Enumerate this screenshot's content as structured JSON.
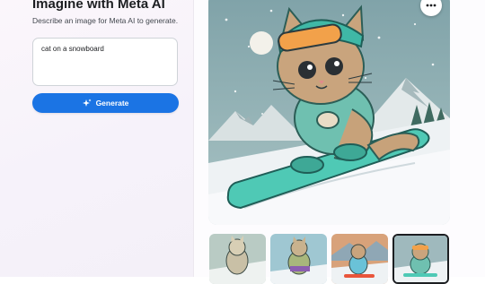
{
  "app": {
    "title": "Imagine with Meta AI",
    "subtitle": "Describe an image for Meta AI to generate."
  },
  "prompt": {
    "value": "cat on a snowboard"
  },
  "generate_button": {
    "label": "Generate",
    "icon": "sparkle-icon"
  },
  "image_options": {
    "icon": "more-options-icon"
  },
  "thumbnails": [
    {
      "name": "variation-1",
      "selected": false
    },
    {
      "name": "variation-2",
      "selected": false
    },
    {
      "name": "variation-3",
      "selected": false
    },
    {
      "name": "variation-4",
      "selected": true
    }
  ],
  "colors": {
    "accent": "#1b74e4",
    "selected_border": "#1c1e21"
  }
}
